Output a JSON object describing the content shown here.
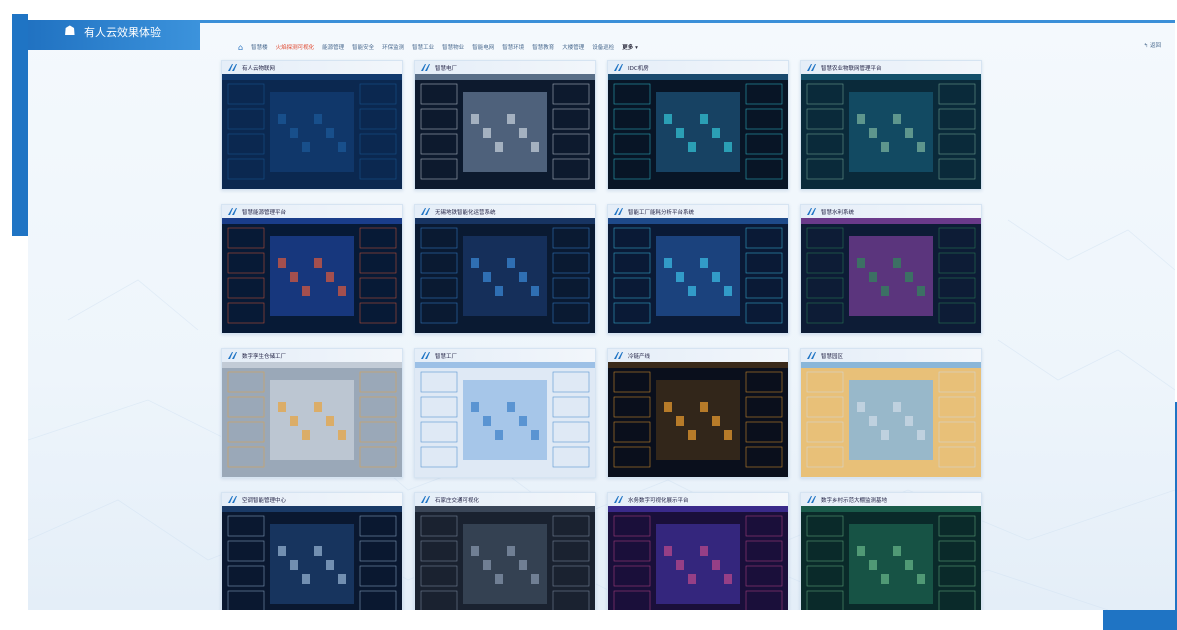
{
  "app": {
    "title": "有人云效果体验"
  },
  "nav": {
    "items": [
      "智慧楼",
      "火焰探测可视化",
      "能源管理",
      "智能安全",
      "环保监测",
      "智慧工业",
      "智慧物业",
      "智能电网",
      "智慧环境",
      "智慧教育",
      "大楼管理",
      "设备巡检"
    ],
    "active_index": 1,
    "more_label": "更多 ▾",
    "back_label": "↰ 返回"
  },
  "cards": [
    {
      "title": "有人云物联网",
      "theme": "dark-blue-dashboard"
    },
    {
      "title": "智慧电厂",
      "theme": "3d-plant"
    },
    {
      "title": "IDC机房",
      "theme": "datacenter"
    },
    {
      "title": "智慧农业物联网管理平台",
      "theme": "teal-dashboard"
    },
    {
      "title": "智慧能源管理平台",
      "theme": "map-dashboard"
    },
    {
      "title": "无锡地铁智能化运营系统",
      "theme": "dark-panels"
    },
    {
      "title": "智能工厂能耗分析平台系统",
      "theme": "bar-dashboard"
    },
    {
      "title": "智慧水利系统",
      "theme": "region-map"
    },
    {
      "title": "数字孪生仓储工厂",
      "theme": "factory-3d"
    },
    {
      "title": "智慧工厂",
      "theme": "china-map"
    },
    {
      "title": "冷链产线",
      "theme": "orange-industrial"
    },
    {
      "title": "智慧园区",
      "theme": "city-park"
    },
    {
      "title": "空调智能管理中心",
      "theme": "hvac"
    },
    {
      "title": "石家庄交通可视化",
      "theme": "traffic-map"
    },
    {
      "title": "水务数字可视化展示平台",
      "theme": "water-3d"
    },
    {
      "title": "数字乡村示范大棚监测基地",
      "theme": "greenhouse"
    }
  ],
  "colors": {
    "accent": "#1f74c4",
    "active_nav": "#e0452b",
    "dashboard_bg": "#0a1c3a"
  }
}
